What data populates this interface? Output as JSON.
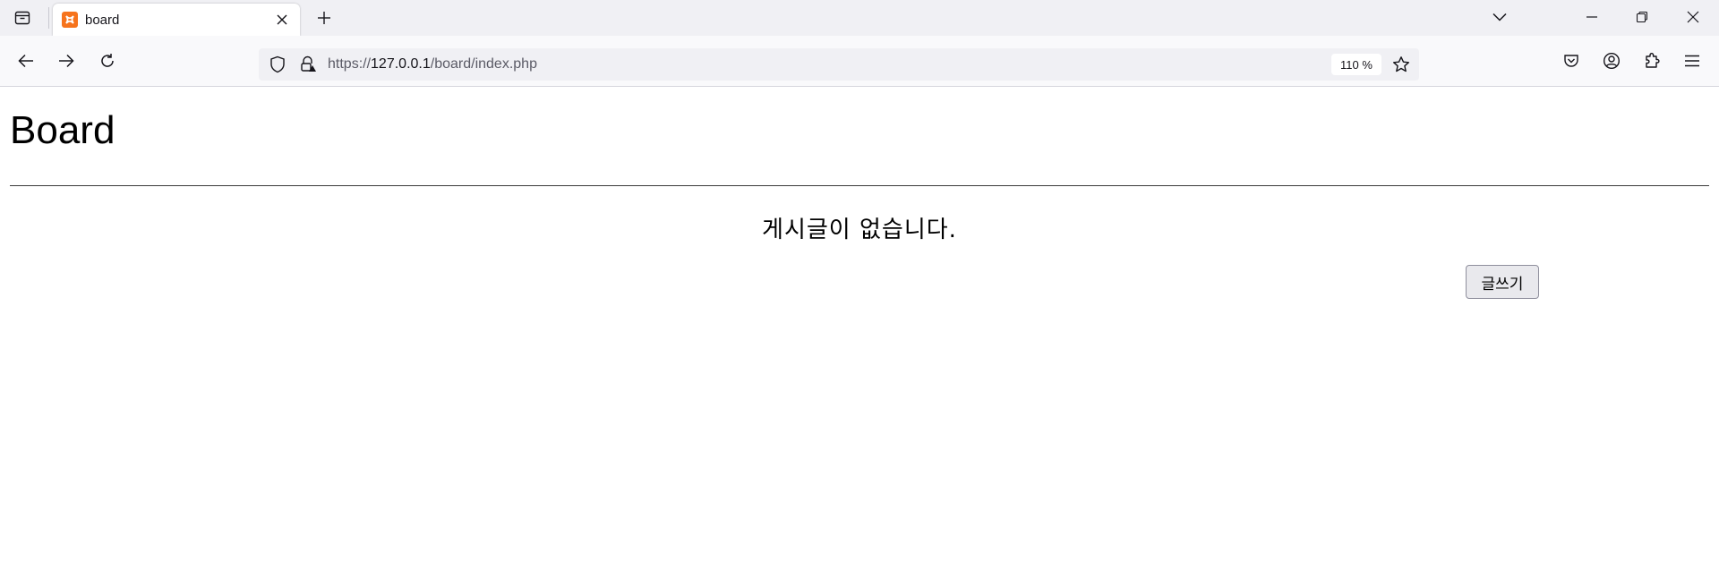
{
  "browser": {
    "tab": {
      "title": "board",
      "favicon": "xampp-icon",
      "favicon_color": "#f6731c"
    },
    "address_bar": {
      "url_scheme": "https://",
      "url_host": "127.0.0.1",
      "url_path": "/board/index.php",
      "zoom": "110 %"
    },
    "icons": {
      "tab_list": "tab-list-icon",
      "new_tab": "plus-icon",
      "tab_close": "close-icon",
      "tabs_dropdown": "chevron-down-icon",
      "minimize": "minimize-icon",
      "restore": "restore-icon",
      "window_close": "close-icon",
      "back": "arrow-left-icon",
      "forward": "arrow-right-icon",
      "reload": "reload-icon",
      "tracking_protection": "shield-icon",
      "site_security": "lock-warning-icon",
      "bookmark": "star-icon",
      "pocket": "pocket-icon",
      "account": "account-icon",
      "extensions": "puzzle-icon",
      "menu": "hamburger-menu-icon"
    }
  },
  "page": {
    "title": "Board",
    "empty_message": "게시글이 없습니다.",
    "write_button_label": "글쓰기"
  }
}
